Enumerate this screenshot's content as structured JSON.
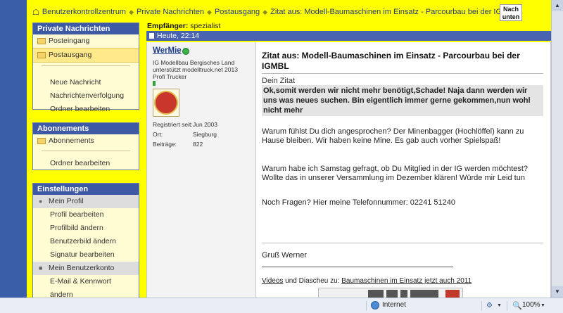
{
  "breadcrumb": [
    "Benutzerkontrollzentrum",
    "Private Nachrichten",
    "Postausgang",
    "Zitat aus: Modell-Baumaschinen im Einsatz - Parcourbau bei der IGMBL"
  ],
  "nach_unten_button": "Nach unten",
  "sidebar": {
    "private": {
      "title": "Private Nachrichten",
      "items": [
        "Posteingang",
        "Postausgang",
        "Neue Nachricht",
        "Nachrichtenverfolgung",
        "Ordner bearbeiten"
      ],
      "active": "Postausgang"
    },
    "abos": {
      "title": "Abonnements",
      "items": [
        "Abonnements",
        "Ordner bearbeiten"
      ]
    },
    "settings": {
      "title": "Einstellungen",
      "items": [
        "Mein Profil",
        "Profil bearbeiten",
        "Profilbild ändern",
        "Benutzerbild ändern",
        "Signatur bearbeiten",
        "Mein Benutzerkonto",
        "E-Mail & Kennwort",
        "ändern"
      ]
    }
  },
  "message": {
    "recipient_label": "Empfänger:",
    "recipient": "spezialist",
    "date": "Heute, 22:14",
    "author": {
      "name": "WerMie",
      "online": true,
      "line1": "IG Modellbau Bergisches Land",
      "line2": "unterstützt modelltruck.net 2013",
      "line3": "Profi Trucker",
      "registered_label": "Registriert seit:",
      "registered": "Jun 2003",
      "location_label": "Ort:",
      "location": "Siegburg",
      "posts_label": "Beiträge:",
      "posts": "822"
    },
    "title": "Zitat aus: Modell-Baumaschinen im Einsatz - Parcourbau bei der IGMBL",
    "quote_label": "Dein Zitat",
    "quote": "Ok,somit werden wir nicht mehr benötigt,Schade! Naja dann werden wir uns was neues suchen. Bin eigentlich immer gerne gekommen,nun wohl nicht mehr",
    "paragraphs": [
      "Warum fühlst Du dich angesprochen? Der Minenbagger (Hochlöffel) kann zu Hause bleiben. Wir haben keine Mine. Es gab auch vorher Spielspaß!",
      "Warum habe ich Samstag gefragt, ob Du Mitglied in der IG werden möchtest? Wollte das in unserer Versammlung im Dezember klären! Würde mir Leid tun",
      "Noch Fragen? Hier meine Telefonnummer: 02241 51240"
    ],
    "signature": "Gruß Werner",
    "video_prefix_link": "Videos",
    "video_middle": " und Diascheu zu: ",
    "video_link": "Baumaschinen im Einsatz jetzt auch 2011"
  },
  "statusbar": {
    "zone": "Internet",
    "zoom": "100%"
  },
  "colors": {
    "forum_bg": "#ffff00",
    "header_blue": "#3f5aa5",
    "window_blue": "#2f5597"
  }
}
